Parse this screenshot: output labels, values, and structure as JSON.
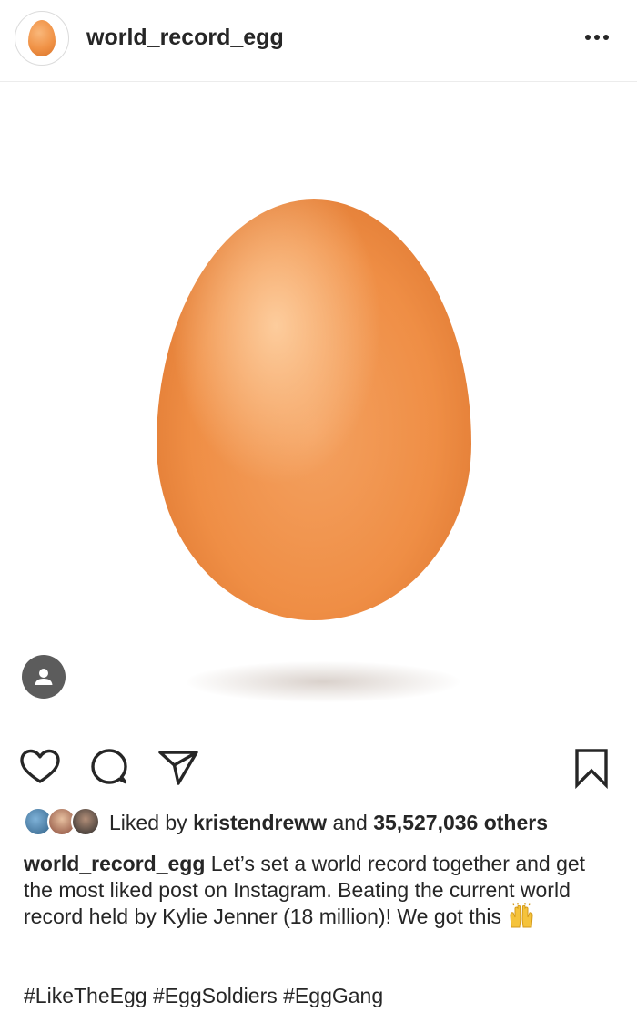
{
  "header": {
    "username": "world_record_egg",
    "avatar_icon": "egg-avatar-icon",
    "more_icon": "more-options-icon"
  },
  "post": {
    "photo_subject": "egg",
    "tag_icon": "person-icon"
  },
  "actions": {
    "like_icon": "heart-icon",
    "comment_icon": "comment-icon",
    "share_icon": "paper-plane-icon",
    "save_icon": "bookmark-icon"
  },
  "likes": {
    "prefix": "Liked by ",
    "user": "kristendreww",
    "middle": " and ",
    "count": "35,527,036 others"
  },
  "caption": {
    "username": "world_record_egg",
    "text": " Let’s set a world record together and get the most liked post on Instagram. Beating the current world record held by Kylie Jenner (18 million)! We got this ",
    "emoji_icon": "raising-hands-emoji-icon"
  },
  "hashtags": [
    "#LikeTheEgg",
    "#EggSoldiers",
    "#EggGang"
  ],
  "colors": {
    "text": "#262626",
    "egg": "#ef8e45",
    "tag_badge": "#5c5c5c",
    "divider": "#ececec"
  }
}
